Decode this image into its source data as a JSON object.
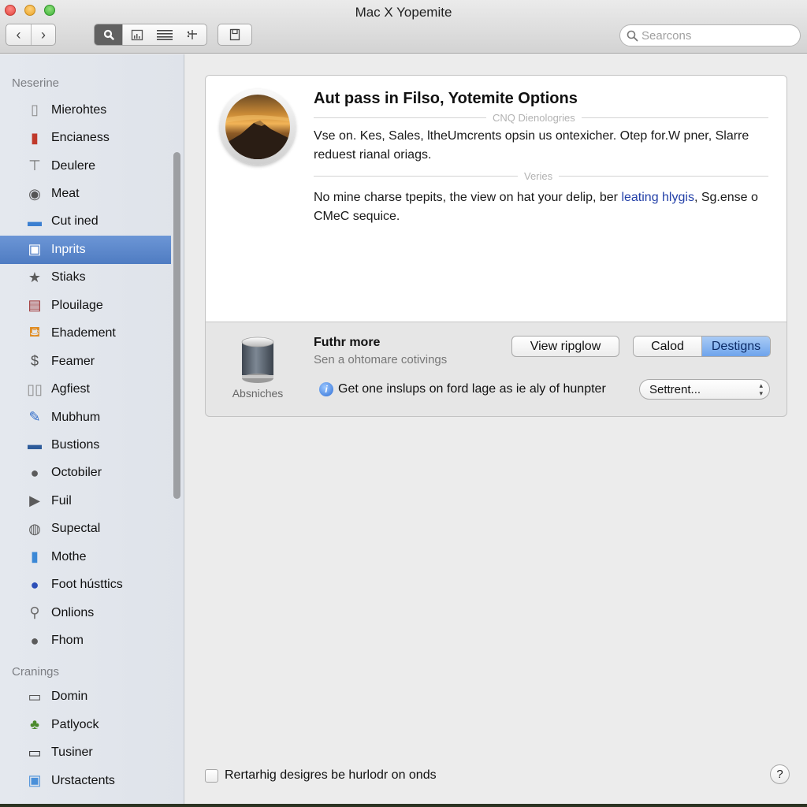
{
  "window": {
    "title": "Mac X Yopemite"
  },
  "toolbar": {
    "back_icon": "chevron-left-icon",
    "forward_icon": "chevron-right-icon",
    "view_buttons": [
      {
        "icon": "search-icon",
        "glyph": "🔍︎",
        "active": true
      },
      {
        "icon": "chart-icon",
        "glyph": "▥",
        "active": false
      },
      {
        "icon": "list-icon",
        "glyph": "☰",
        "active": false
      },
      {
        "icon": "branch-icon",
        "glyph": "⑂",
        "active": false
      }
    ],
    "share_icon": "document-icon",
    "search_placeholder": "Searcons"
  },
  "sidebar": {
    "sections": [
      {
        "title": "Neserine",
        "items": [
          {
            "label": "Mierohtes",
            "icon": "device-icon",
            "glyph": "▯",
            "color": "#8a8a8a",
            "selected": false
          },
          {
            "label": "Encianess",
            "icon": "battery-icon",
            "glyph": "▮",
            "color": "#c0392b",
            "selected": false
          },
          {
            "label": "Deulere",
            "icon": "stamp-icon",
            "glyph": "⊤",
            "color": "#6d6d6d",
            "selected": false
          },
          {
            "label": "Meat",
            "icon": "lock-circle-icon",
            "glyph": "◉",
            "color": "#555555",
            "selected": false
          },
          {
            "label": "Cut ined",
            "icon": "display-icon",
            "glyph": "▬",
            "color": "#3b7fd1",
            "selected": false
          },
          {
            "label": "Inprits",
            "icon": "window-icon",
            "glyph": "▣",
            "color": "#2f6bc8",
            "selected": true
          },
          {
            "label": "Stiaks",
            "icon": "star-icon",
            "glyph": "★",
            "color": "#5b5b5b",
            "selected": false
          },
          {
            "label": "Plouilage",
            "icon": "calendar-icon",
            "glyph": "▤",
            "color": "#9c2f2f",
            "selected": false
          },
          {
            "label": "Ehadement",
            "icon": "jar-icon",
            "glyph": "⛾",
            "color": "#e08a1e",
            "selected": false
          },
          {
            "label": "Feamer",
            "icon": "dollar-icon",
            "glyph": "$",
            "color": "#555555",
            "selected": false
          },
          {
            "label": "Agfiest",
            "icon": "book-icon",
            "glyph": "▯▯",
            "color": "#8c8c8c",
            "selected": false
          },
          {
            "label": "Mubhum",
            "icon": "wrench-icon",
            "glyph": "✎",
            "color": "#2f6bc8",
            "selected": false
          },
          {
            "label": "Bustions",
            "icon": "screen-icon",
            "glyph": "▬",
            "color": "#2d5b9a",
            "selected": false
          },
          {
            "label": "Octobiler",
            "icon": "user-icon",
            "glyph": "●",
            "color": "#5b5b5b",
            "selected": false
          },
          {
            "label": "Fuil",
            "icon": "play-icon",
            "glyph": "▶",
            "color": "#5b5b5b",
            "selected": false
          },
          {
            "label": "Supectal",
            "icon": "headphones-icon",
            "glyph": "◍",
            "color": "#5b5b5b",
            "selected": false
          },
          {
            "label": "Mothe",
            "icon": "phone-icon",
            "glyph": "▮",
            "color": "#3b88d6",
            "selected": false
          },
          {
            "label": "Foot hústtics",
            "icon": "globe-icon",
            "glyph": "●",
            "color": "#2c4fb8",
            "selected": false
          },
          {
            "label": "Onlions",
            "icon": "pin-icon",
            "glyph": "⚲",
            "color": "#6d6d6d",
            "selected": false
          },
          {
            "label": "Fhom",
            "icon": "person-icon",
            "glyph": "●",
            "color": "#5b5b5b",
            "selected": false
          }
        ]
      },
      {
        "title": "Cranings",
        "items": [
          {
            "label": "Domin",
            "icon": "monitor-icon",
            "glyph": "▭",
            "color": "#555555",
            "selected": false
          },
          {
            "label": "Patlyock",
            "icon": "plant-icon",
            "glyph": "♣",
            "color": "#4b8a2c",
            "selected": false
          },
          {
            "label": "Tusiner",
            "icon": "tablet-icon",
            "glyph": "▭",
            "color": "#333333",
            "selected": false
          },
          {
            "label": "Urstactents",
            "icon": "presentation-icon",
            "glyph": "▣",
            "color": "#4a90d9",
            "selected": false
          }
        ]
      }
    ]
  },
  "panel": {
    "title": "Aut pass in Filso, Yotemite Options",
    "divider1_label": "CNQ Dienologries",
    "paragraph1": "Vse on. Kes, Sales, ltheUmcrents opsin us ontexicher. Otep for.W pner, Slarre reduest rianal oriags.",
    "divider2_label": "Veries",
    "paragraph2_before": "No mine charse tpepits, the view on hat your delip, ber ",
    "paragraph2_link": "leating hlygis",
    "paragraph2_after": ", Sg.ense o CMeC sequice."
  },
  "further": {
    "db_label": "Absniches",
    "title": "Futhr more",
    "subtitle": "Sen a ohtomare cotivings",
    "info_text": "Get one inslups on ford lage as ie aly of hunpter",
    "view_button": "View ripglow",
    "segments": [
      {
        "label": "Calod",
        "active": false
      },
      {
        "label": "Destigns",
        "active": true
      }
    ],
    "popup_value": "Settrent..."
  },
  "footer": {
    "checkbox_label": "Rertarhig desigres be hurlodr on onds",
    "checkbox_checked": false,
    "help_label": "?"
  }
}
